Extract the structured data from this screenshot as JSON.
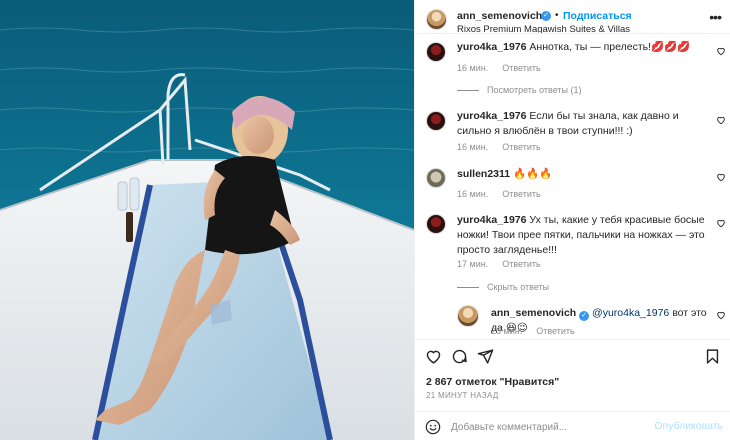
{
  "post": {
    "author": "ann_semenovich",
    "follow_label": "Подписаться",
    "location": "Rixos Premium Magawish Suites & Villas",
    "more_icon": "more-horizontal-icon"
  },
  "comments": [
    {
      "username": "yuro4ka_1976",
      "text": "Аннотка, ты — прелесть!💋💋💋",
      "time": "16 мин.",
      "reply_label": "Ответить",
      "toggle": "Посмотреть ответы (1)"
    },
    {
      "username": "yuro4ka_1976",
      "text": "Если бы ты знала, как давно и сильно я влюблён в твои ступни!!! :)",
      "time": "16 мин.",
      "reply_label": "Ответить"
    },
    {
      "username": "sullen2311",
      "text": "🔥🔥🔥",
      "time": "16 мин.",
      "reply_label": "Ответить"
    },
    {
      "username": "yuro4ka_1976",
      "text": "Ух ты, какие у тебя красивые босые ножки! Твои прее пятки, пальчики на ножках — это просто загляденье!!!",
      "time": "17 мин.",
      "reply_label": "Ответить",
      "toggle": "Скрыть ответы"
    }
  ],
  "reply": {
    "username": "ann_semenovich",
    "mention": "@yuro4ka_1976",
    "text": "вот это да 😆😉",
    "time": "23 мин.",
    "reply_label": "Ответить"
  },
  "actions": {
    "likes": "2 867 отметок \"Нравится\"",
    "time_ago": "21 МИНУТ НАЗАД",
    "comment_placeholder": "Добавьте комментарий...",
    "publish_label": "Опубликовать"
  },
  "colors": {
    "accent": "#0095f6",
    "publish_disabled": "#b2dffc",
    "muted": "#8e8e8e",
    "sea": "#0f6f8c"
  }
}
